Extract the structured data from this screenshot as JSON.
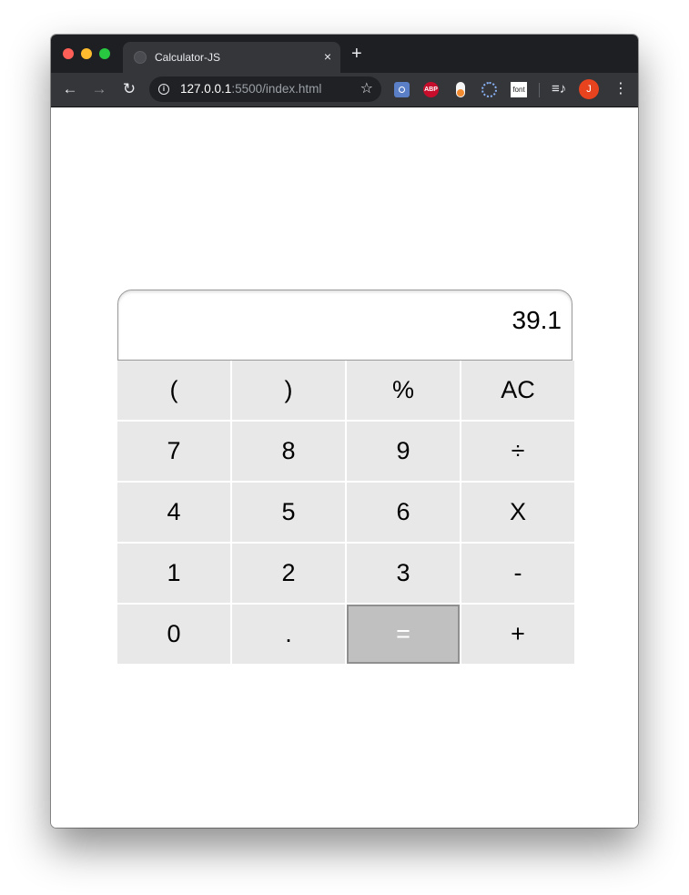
{
  "browser": {
    "tab_title": "Calculator-JS",
    "tab_close": "×",
    "new_tab": "+",
    "url_host": "127.0.0.1",
    "url_path": ":5500/index.html",
    "extensions": {
      "abp_label": "ABP",
      "font_label": "font"
    },
    "avatar_initial": "J",
    "icons": {
      "back": "back-arrow-icon",
      "forward": "forward-arrow-icon",
      "reload": "reload-icon",
      "info": "info-icon",
      "star": "star-icon",
      "menu": "more-vert-icon"
    }
  },
  "calculator": {
    "display": "39.1",
    "keys": [
      {
        "label": "(",
        "name": "key-open-paren"
      },
      {
        "label": ")",
        "name": "key-close-paren"
      },
      {
        "label": "%",
        "name": "key-percent"
      },
      {
        "label": "AC",
        "name": "key-clear"
      },
      {
        "label": "7",
        "name": "key-7"
      },
      {
        "label": "8",
        "name": "key-8"
      },
      {
        "label": "9",
        "name": "key-9"
      },
      {
        "label": "÷",
        "name": "key-divide"
      },
      {
        "label": "4",
        "name": "key-4"
      },
      {
        "label": "5",
        "name": "key-5"
      },
      {
        "label": "6",
        "name": "key-6"
      },
      {
        "label": "X",
        "name": "key-multiply"
      },
      {
        "label": "1",
        "name": "key-1"
      },
      {
        "label": "2",
        "name": "key-2"
      },
      {
        "label": "3",
        "name": "key-3"
      },
      {
        "label": "-",
        "name": "key-subtract"
      },
      {
        "label": "0",
        "name": "key-0"
      },
      {
        "label": ".",
        "name": "key-decimal"
      },
      {
        "label": "=",
        "name": "key-equals"
      },
      {
        "label": "+",
        "name": "key-add"
      }
    ],
    "colors": {
      "key_bg": "#e8e8e8",
      "equals_bg": "#c0c0c0"
    }
  }
}
